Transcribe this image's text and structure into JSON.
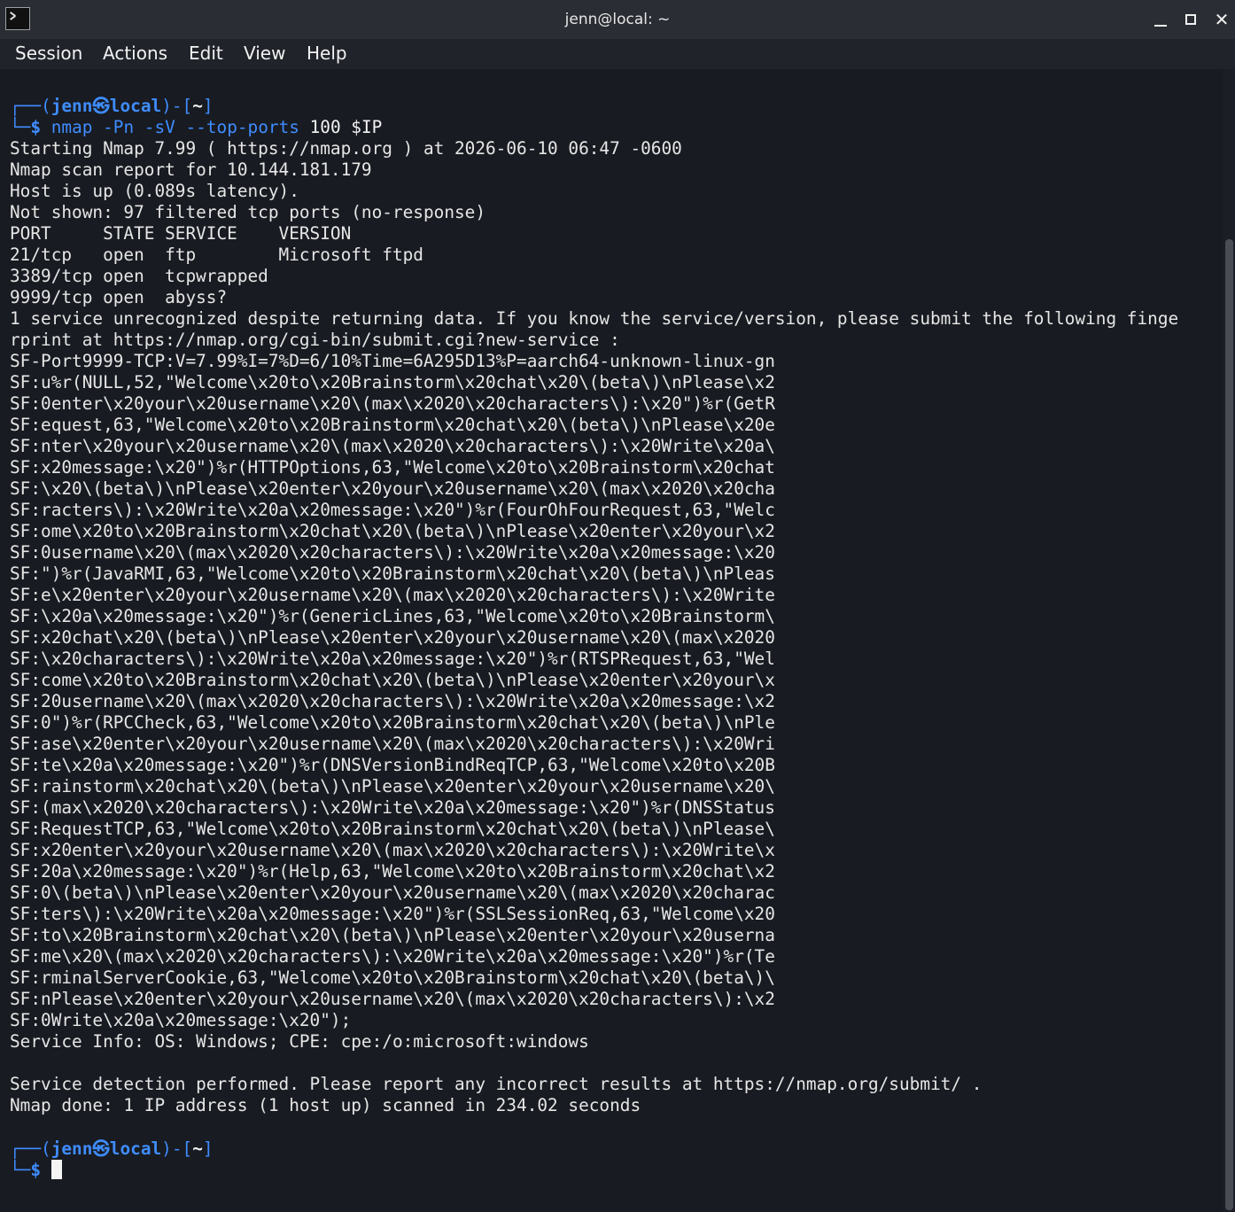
{
  "window": {
    "title": "jenn@local: ~"
  },
  "menubar": {
    "items": [
      "Session",
      "Actions",
      "Edit",
      "View",
      "Help"
    ]
  },
  "prompt": {
    "user": "jenn",
    "at_symbol": "㉿",
    "host": "local",
    "dir": "~",
    "dollar": "$"
  },
  "command": {
    "name": "nmap",
    "args": " -Pn -sV --top-ports",
    "rest": " 100 $IP"
  },
  "output": [
    "Starting Nmap 7.99 ( https://nmap.org ) at 2026-06-10 06:47 -0600",
    "Nmap scan report for 10.144.181.179",
    "Host is up (0.089s latency).",
    "Not shown: 97 filtered tcp ports (no-response)",
    "PORT     STATE SERVICE    VERSION",
    "21/tcp   open  ftp        Microsoft ftpd",
    "3389/tcp open  tcpwrapped",
    "9999/tcp open  abyss?",
    "1 service unrecognized despite returning data. If you know the service/version, please submit the following finge",
    "rprint at https://nmap.org/cgi-bin/submit.cgi?new-service :",
    "SF-Port9999-TCP:V=7.99%I=7%D=6/10%Time=6A295D13%P=aarch64-unknown-linux-gn",
    "SF:u%r(NULL,52,\"Welcome\\x20to\\x20Brainstorm\\x20chat\\x20\\(beta\\)\\nPlease\\x2",
    "SF:0enter\\x20your\\x20username\\x20\\(max\\x2020\\x20characters\\):\\x20\")%r(GetR",
    "SF:equest,63,\"Welcome\\x20to\\x20Brainstorm\\x20chat\\x20\\(beta\\)\\nPlease\\x20e",
    "SF:nter\\x20your\\x20username\\x20\\(max\\x2020\\x20characters\\):\\x20Write\\x20a\\",
    "SF:x20message:\\x20\")%r(HTTPOptions,63,\"Welcome\\x20to\\x20Brainstorm\\x20chat",
    "SF:\\x20\\(beta\\)\\nPlease\\x20enter\\x20your\\x20username\\x20\\(max\\x2020\\x20cha",
    "SF:racters\\):\\x20Write\\x20a\\x20message:\\x20\")%r(FourOhFourRequest,63,\"Welc",
    "SF:ome\\x20to\\x20Brainstorm\\x20chat\\x20\\(beta\\)\\nPlease\\x20enter\\x20your\\x2",
    "SF:0username\\x20\\(max\\x2020\\x20characters\\):\\x20Write\\x20a\\x20message:\\x20",
    "SF:\")%r(JavaRMI,63,\"Welcome\\x20to\\x20Brainstorm\\x20chat\\x20\\(beta\\)\\nPleas",
    "SF:e\\x20enter\\x20your\\x20username\\x20\\(max\\x2020\\x20characters\\):\\x20Write",
    "SF:\\x20a\\x20message:\\x20\")%r(GenericLines,63,\"Welcome\\x20to\\x20Brainstorm\\",
    "SF:x20chat\\x20\\(beta\\)\\nPlease\\x20enter\\x20your\\x20username\\x20\\(max\\x2020",
    "SF:\\x20characters\\):\\x20Write\\x20a\\x20message:\\x20\")%r(RTSPRequest,63,\"Wel",
    "SF:come\\x20to\\x20Brainstorm\\x20chat\\x20\\(beta\\)\\nPlease\\x20enter\\x20your\\x",
    "SF:20username\\x20\\(max\\x2020\\x20characters\\):\\x20Write\\x20a\\x20message:\\x2",
    "SF:0\")%r(RPCCheck,63,\"Welcome\\x20to\\x20Brainstorm\\x20chat\\x20\\(beta\\)\\nPle",
    "SF:ase\\x20enter\\x20your\\x20username\\x20\\(max\\x2020\\x20characters\\):\\x20Wri",
    "SF:te\\x20a\\x20message:\\x20\")%r(DNSVersionBindReqTCP,63,\"Welcome\\x20to\\x20B",
    "SF:rainstorm\\x20chat\\x20\\(beta\\)\\nPlease\\x20enter\\x20your\\x20username\\x20\\",
    "SF:(max\\x2020\\x20characters\\):\\x20Write\\x20a\\x20message:\\x20\")%r(DNSStatus",
    "SF:RequestTCP,63,\"Welcome\\x20to\\x20Brainstorm\\x20chat\\x20\\(beta\\)\\nPlease\\",
    "SF:x20enter\\x20your\\x20username\\x20\\(max\\x2020\\x20characters\\):\\x20Write\\x",
    "SF:20a\\x20message:\\x20\")%r(Help,63,\"Welcome\\x20to\\x20Brainstorm\\x20chat\\x2",
    "SF:0\\(beta\\)\\nPlease\\x20enter\\x20your\\x20username\\x20\\(max\\x2020\\x20charac",
    "SF:ters\\):\\x20Write\\x20a\\x20message:\\x20\")%r(SSLSessionReq,63,\"Welcome\\x20",
    "SF:to\\x20Brainstorm\\x20chat\\x20\\(beta\\)\\nPlease\\x20enter\\x20your\\x20userna",
    "SF:me\\x20\\(max\\x2020\\x20characters\\):\\x20Write\\x20a\\x20message:\\x20\")%r(Te",
    "SF:rminalServerCookie,63,\"Welcome\\x20to\\x20Brainstorm\\x20chat\\x20\\(beta\\)\\",
    "SF:nPlease\\x20enter\\x20your\\x20username\\x20\\(max\\x2020\\x20characters\\):\\x2",
    "SF:0Write\\x20a\\x20message:\\x20\");",
    "Service Info: OS: Windows; CPE: cpe:/o:microsoft:windows",
    "",
    "Service detection performed. Please report any incorrect results at https://nmap.org/submit/ .",
    "Nmap done: 1 IP address (1 host up) scanned in 234.02 seconds"
  ]
}
